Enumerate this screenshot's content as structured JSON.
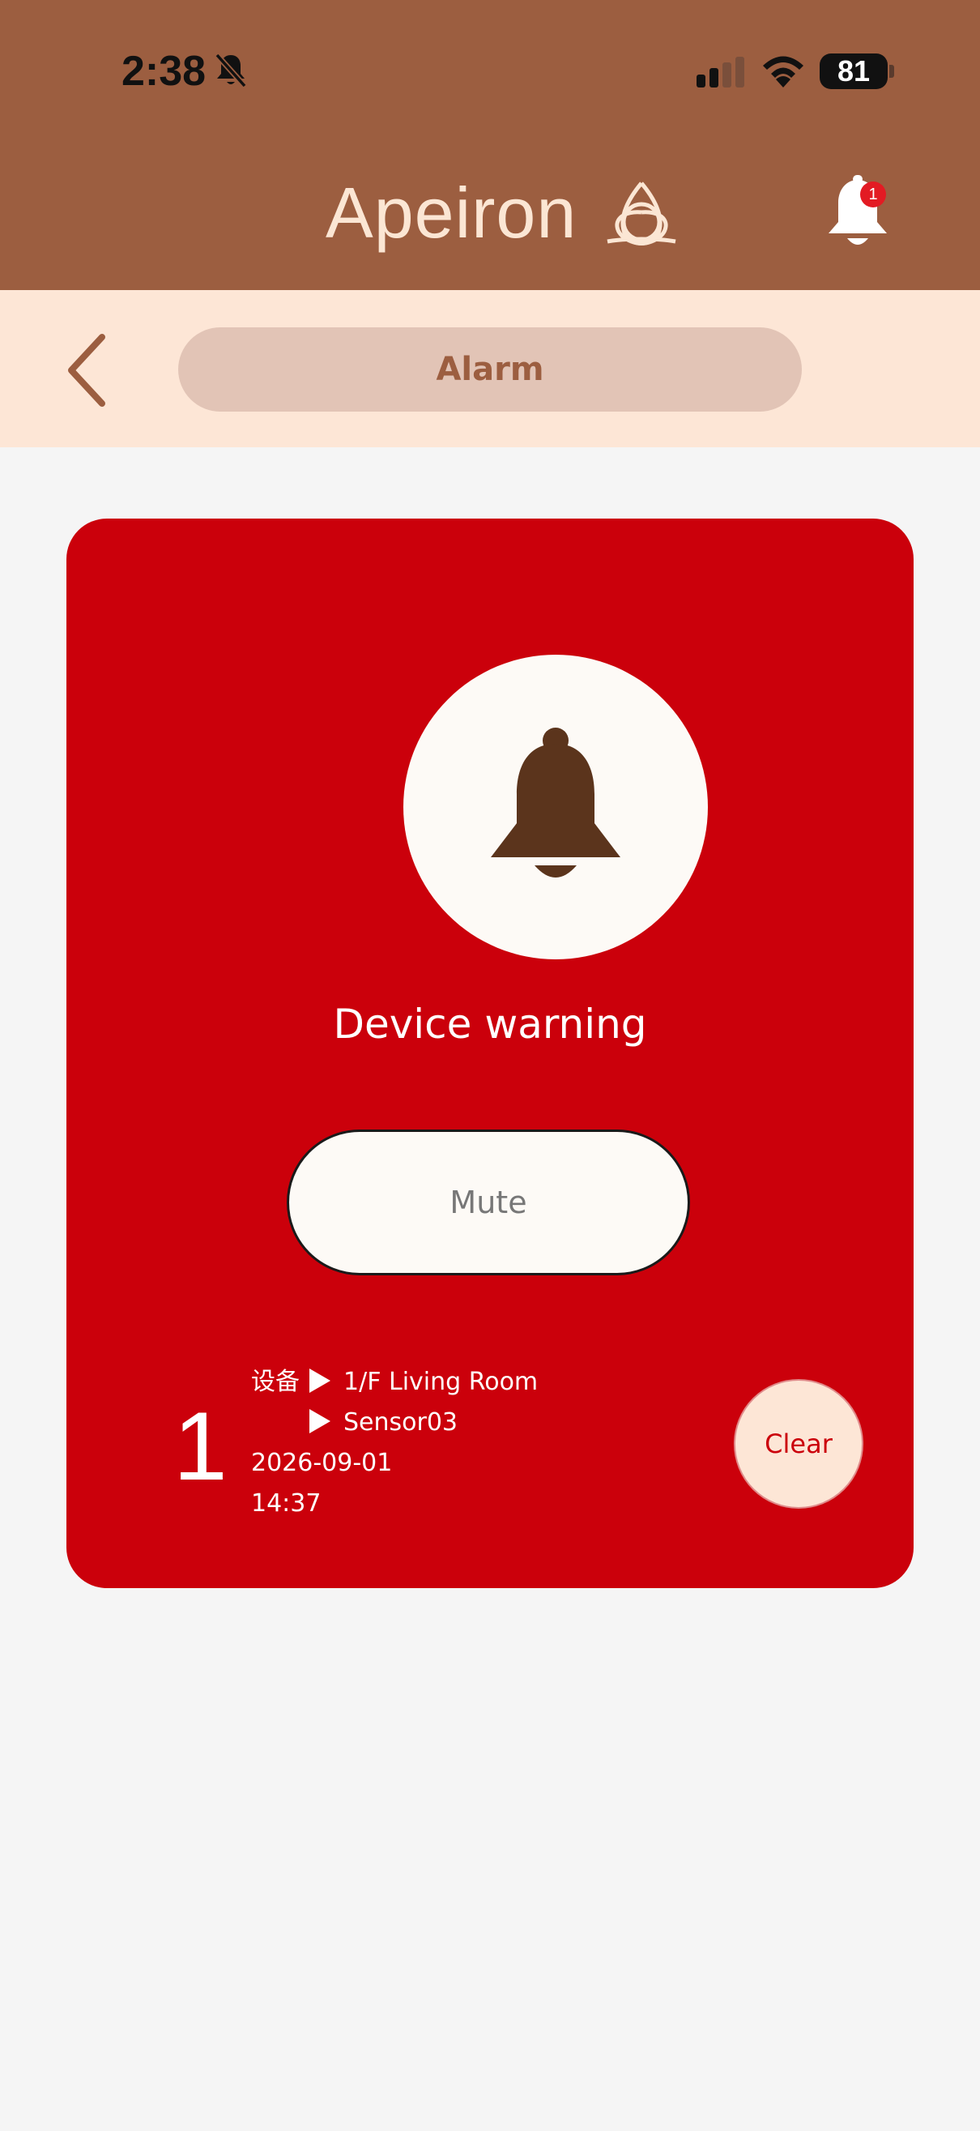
{
  "status_bar": {
    "time": "2:38",
    "battery": "81",
    "icons": [
      "silent-bell-icon",
      "cellular-signal-icon",
      "wifi-icon",
      "battery-icon"
    ]
  },
  "header": {
    "logo_text": "Apeiron",
    "notification_count": "1"
  },
  "title_bar": {
    "title": "Alarm"
  },
  "alarm": {
    "title": "Device warning",
    "mute_label": "Mute",
    "count": "1",
    "device_label": "设备",
    "location": "1/F Living Room",
    "sensor": "Sensor03",
    "date": "2026-09-01",
    "time": "14:37",
    "clear_label": "Clear"
  },
  "colors": {
    "header_bg": "#9c5e40",
    "title_bar_bg": "#fde6d6",
    "title_pill_bg": "#e2c4b6",
    "alarm_red": "#cb000b",
    "bell_brown": "#5b341c",
    "page_bg": "#f5f5f5"
  }
}
